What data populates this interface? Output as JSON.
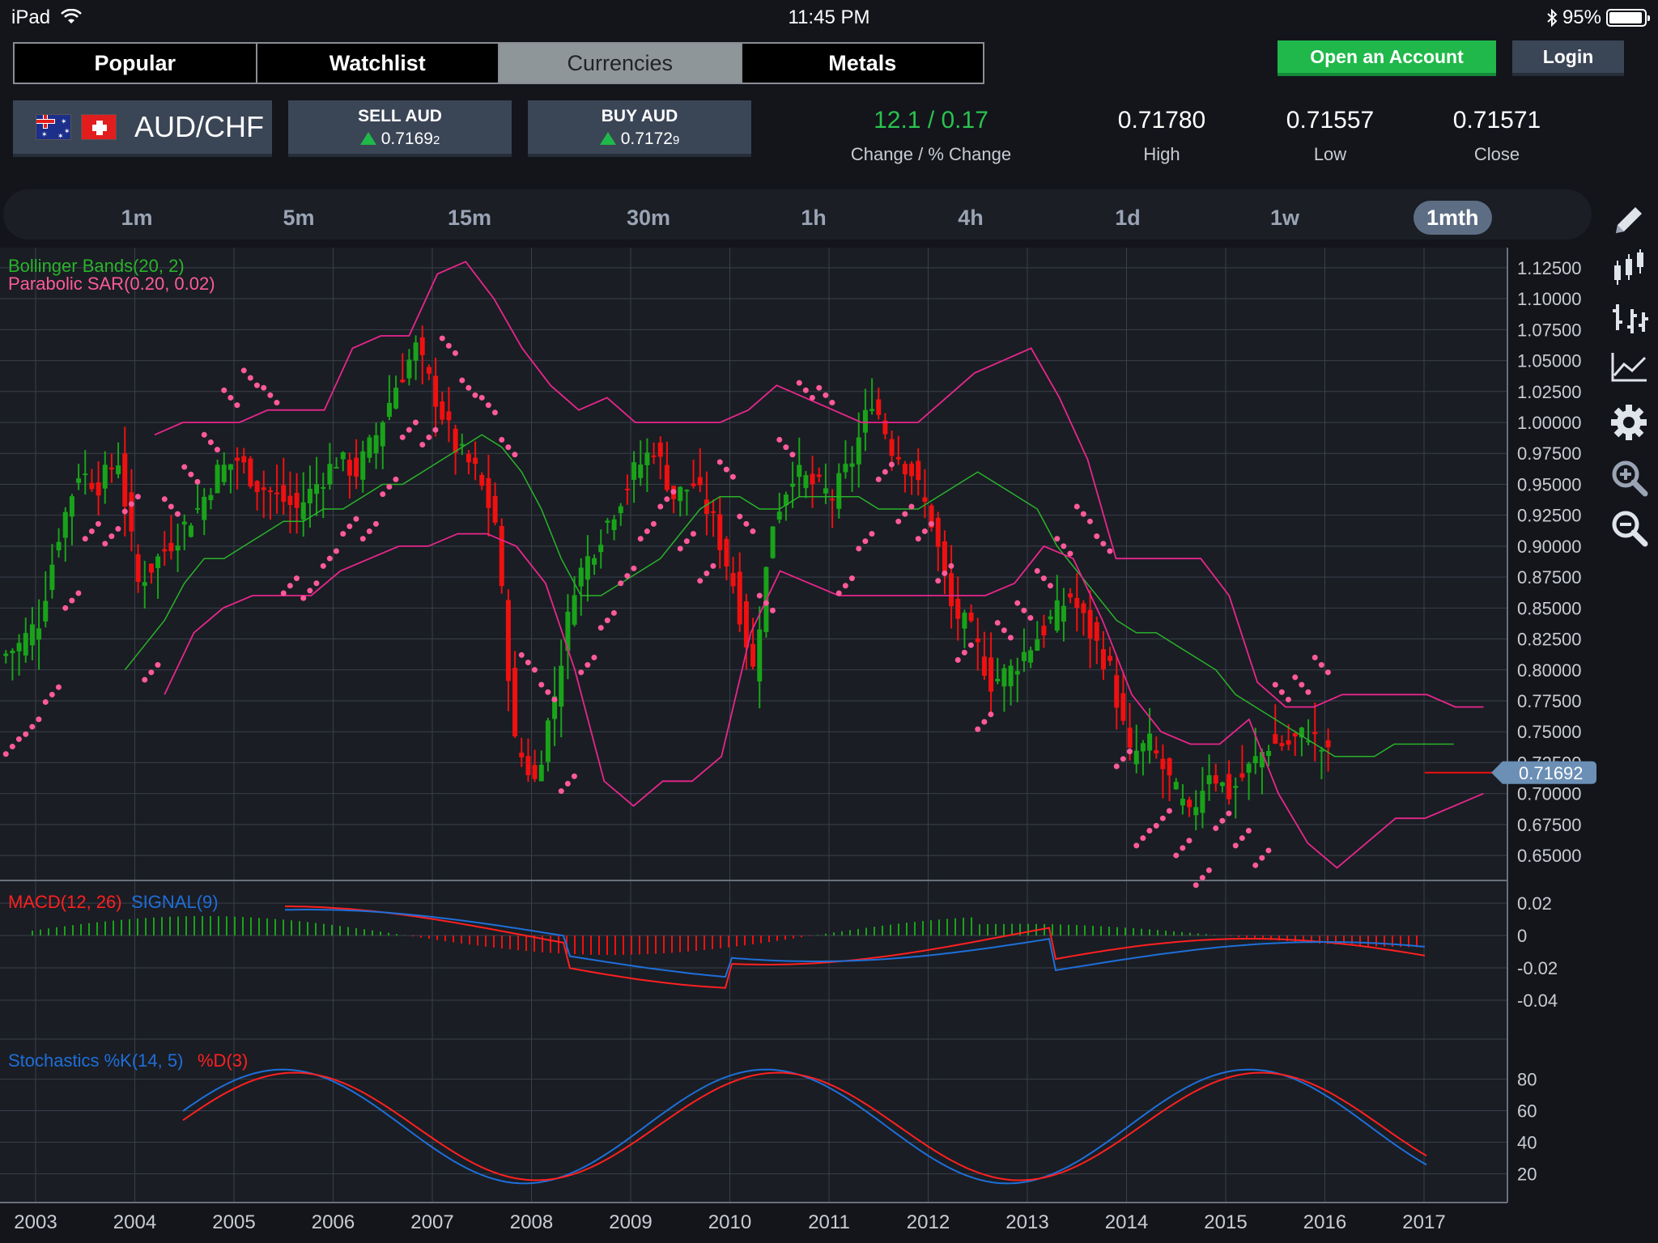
{
  "status_bar": {
    "device": "iPad",
    "time": "11:45 PM",
    "battery": "95%",
    "battery_level": 0.95
  },
  "nav_tabs": [
    {
      "label": "Popular",
      "active": false
    },
    {
      "label": "Watchlist",
      "active": false
    },
    {
      "label": "Currencies",
      "active": true
    },
    {
      "label": "Metals",
      "active": false
    }
  ],
  "header_buttons": {
    "open_account": "Open an Account",
    "login": "Login"
  },
  "instrument": {
    "pair": "AUD/CHF",
    "flags": [
      "australia-flag",
      "switzerland-flag"
    ]
  },
  "sell": {
    "label": "SELL AUD",
    "price_main": "0.7169",
    "price_pip": "2"
  },
  "buy": {
    "label": "BUY AUD",
    "price_main": "0.7172",
    "price_pip": "9"
  },
  "stats": {
    "change_value": "12.1 / 0.17",
    "change_label": "Change / % Change",
    "high_value": "0.71780",
    "high_label": "High",
    "low_value": "0.71557",
    "low_label": "Low",
    "close_value": "0.71571",
    "close_label": "Close"
  },
  "timeframes": [
    {
      "label": "1m",
      "active": false
    },
    {
      "label": "5m",
      "active": false
    },
    {
      "label": "15m",
      "active": false
    },
    {
      "label": "30m",
      "active": false
    },
    {
      "label": "1h",
      "active": false
    },
    {
      "label": "4h",
      "active": false
    },
    {
      "label": "1d",
      "active": false
    },
    {
      "label": "1w",
      "active": false
    },
    {
      "label": "1mth",
      "active": true
    }
  ],
  "tools": [
    "pencil-icon",
    "candlestick-icon",
    "ohlc-bars-icon",
    "line-chart-icon",
    "gear-icon",
    "zoom-in-icon",
    "zoom-out-icon"
  ],
  "colors": {
    "green_candle": "#19a319",
    "red_candle": "#f01010",
    "bollinger": "#2ab32a",
    "band_outer": "#e8268c",
    "sar": "#ff5a9a",
    "macd": "#ff2020",
    "signal": "#1e6fd9",
    "stoch_k": "#1e6fd9",
    "stoch_d": "#ff2020",
    "accent_green": "#20b84a"
  },
  "chart_data": {
    "type": "candlestick",
    "symbol": "AUD/CHF",
    "interval": "1mth",
    "current_price": "0.71692",
    "x_ticks": [
      "2003",
      "2004",
      "2005",
      "2006",
      "2007",
      "2008",
      "2009",
      "2010",
      "2011",
      "2012",
      "2013",
      "2014",
      "2015",
      "2016",
      "2017"
    ],
    "xlim": [
      2003.0,
      2018.2
    ],
    "price_axis": {
      "ticks": [
        "1.12500",
        "1.10000",
        "1.07500",
        "1.05000",
        "1.02500",
        "1.00000",
        "0.97500",
        "0.95000",
        "0.92500",
        "0.90000",
        "0.87500",
        "0.85000",
        "0.82500",
        "0.80000",
        "0.77500",
        "0.75000",
        "0.72500",
        "0.70000",
        "0.67500",
        "0.65000"
      ],
      "ylim": [
        0.635,
        1.14
      ]
    },
    "indicators_main": {
      "bollinger_label": "Bollinger Bands(20, 2)",
      "sar_label": "Parabolic SAR(0.20, 0.02)"
    },
    "close_series": {
      "x": [
        2002.7,
        2002.9,
        2003.1,
        2003.3,
        2003.5,
        2003.7,
        2003.9,
        2004.1,
        2004.3,
        2004.5,
        2004.7,
        2004.9,
        2005.1,
        2005.3,
        2005.5,
        2005.7,
        2005.9,
        2006.1,
        2006.3,
        2006.5,
        2006.7,
        2006.9,
        2007.1,
        2007.3,
        2007.5,
        2007.7,
        2007.9,
        2008.1,
        2008.3,
        2008.5,
        2008.7,
        2008.9,
        2009.1,
        2009.3,
        2009.5,
        2009.7,
        2009.9,
        2010.1,
        2010.3,
        2010.5,
        2010.7,
        2010.9,
        2011.1,
        2011.3,
        2011.5,
        2011.7,
        2011.9,
        2012.1,
        2012.3,
        2012.5,
        2012.7,
        2012.9,
        2013.1,
        2013.3,
        2013.5,
        2013.7,
        2013.9,
        2014.1,
        2014.3,
        2014.5,
        2014.7,
        2014.9,
        2015.1,
        2015.3,
        2015.5,
        2015.7,
        2015.9,
        2016.1,
        2016.3,
        2016.5,
        2016.7,
        2016.9,
        2017.1,
        2017.3
      ],
      "close": [
        0.81,
        0.82,
        0.84,
        0.91,
        0.96,
        0.95,
        0.97,
        0.87,
        0.89,
        0.91,
        0.93,
        0.96,
        0.97,
        0.95,
        0.94,
        0.93,
        0.95,
        0.97,
        0.96,
        0.99,
        1.03,
        1.06,
        1.02,
        0.98,
        0.96,
        0.92,
        0.74,
        0.71,
        0.78,
        0.87,
        0.9,
        0.93,
        0.96,
        0.98,
        0.94,
        0.95,
        0.92,
        0.87,
        0.8,
        0.92,
        0.96,
        0.95,
        0.94,
        0.97,
        1.02,
        0.98,
        0.96,
        0.92,
        0.85,
        0.83,
        0.79,
        0.8,
        0.82,
        0.84,
        0.86,
        0.83,
        0.8,
        0.73,
        0.74,
        0.71,
        0.68,
        0.72,
        0.7,
        0.72,
        0.74,
        0.74,
        0.75,
        0.73
      ],
      "bb_mid": [
        0.8,
        0.82,
        0.84,
        0.87,
        0.89,
        0.89,
        0.9,
        0.91,
        0.92,
        0.92,
        0.93,
        0.93,
        0.94,
        0.95,
        0.95,
        0.96,
        0.97,
        0.98,
        0.99,
        0.98,
        0.96,
        0.93,
        0.89,
        0.86,
        0.86,
        0.87,
        0.88,
        0.89,
        0.91,
        0.93,
        0.94,
        0.94,
        0.93,
        0.93,
        0.94,
        0.94,
        0.94,
        0.94,
        0.93,
        0.93,
        0.93,
        0.94,
        0.95,
        0.96,
        0.95,
        0.94,
        0.93,
        0.9,
        0.88,
        0.86,
        0.84,
        0.83,
        0.83,
        0.82,
        0.81,
        0.8,
        0.78,
        0.77,
        0.76,
        0.75,
        0.74,
        0.73,
        0.73,
        0.73,
        0.74,
        0.74,
        0.74,
        0.74
      ],
      "bb_upper": [
        0.99,
        1.0,
        1.0,
        1.0,
        1.01,
        1.01,
        1.01,
        1.06,
        1.07,
        1.07,
        1.12,
        1.13,
        1.1,
        1.06,
        1.03,
        1.01,
        1.02,
        1.0,
        1.0,
        1.0,
        1.0,
        1.01,
        1.03,
        1.02,
        1.01,
        1.0,
        1.0,
        1.0,
        1.02,
        1.04,
        1.05,
        1.06,
        1.02,
        0.97,
        0.89,
        0.89,
        0.89,
        0.89,
        0.86,
        0.79,
        0.77,
        0.77,
        0.78,
        0.78,
        0.78,
        0.78,
        0.77,
        0.77
      ],
      "bb_lower": [
        0.78,
        0.83,
        0.85,
        0.86,
        0.86,
        0.86,
        0.88,
        0.89,
        0.9,
        0.9,
        0.91,
        0.91,
        0.9,
        0.87,
        0.8,
        0.71,
        0.69,
        0.71,
        0.71,
        0.73,
        0.83,
        0.88,
        0.87,
        0.86,
        0.86,
        0.86,
        0.86,
        0.86,
        0.86,
        0.87,
        0.9,
        0.89,
        0.84,
        0.78,
        0.75,
        0.74,
        0.74,
        0.76,
        0.7,
        0.66,
        0.64,
        0.66,
        0.68,
        0.68,
        0.69,
        0.7
      ]
    },
    "macd": {
      "label_macd": "MACD(12, 26)",
      "label_signal": "SIGNAL(9)",
      "ticks": [
        "0.02",
        "0",
        "-0.02",
        "-0.04"
      ],
      "ylim": [
        -0.06,
        0.03
      ]
    },
    "stochastics": {
      "label_k": "Stochastics %K(14, 5)",
      "label_d": "%D(3)",
      "ticks": [
        "80",
        "60",
        "40",
        "20"
      ],
      "ylim": [
        5,
        95
      ]
    }
  }
}
